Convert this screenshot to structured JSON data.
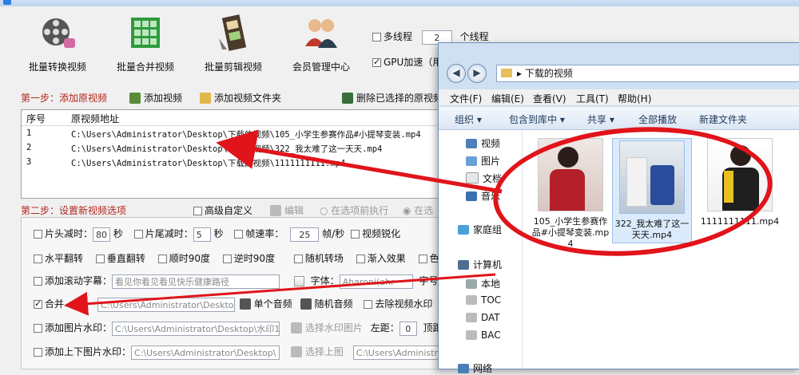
{
  "app": {
    "toolbar": [
      {
        "label": "批量转换视频",
        "icon": "film-reel-icon"
      },
      {
        "label": "批量合并视频",
        "icon": "merge-grid-icon"
      },
      {
        "label": "批量剪辑视频",
        "icon": "film-edit-icon"
      },
      {
        "label": "会员管理中心",
        "icon": "members-icon"
      }
    ],
    "multithread": {
      "label": "多线程",
      "value": "2",
      "suffix": "个线程",
      "checked": false
    },
    "gpu": {
      "label": "GPU加速（用",
      "checked": true
    },
    "step1": {
      "title": "第一步：添加原视频",
      "add_video": "添加视频",
      "add_folder": "添加视频文件夹",
      "delete_selected": "删除已选择的原视频"
    },
    "file_list": {
      "columns": [
        "序号",
        "原视频地址"
      ],
      "rows": [
        {
          "index": "1",
          "path": "C:\\Users\\Administrator\\Desktop\\下载的视频\\105_小学生参赛作品#小提琴变装.mp4"
        },
        {
          "index": "2",
          "path": "C:\\Users\\Administrator\\Desktop\\下载的视频\\322_我太难了这一天天.mp4"
        },
        {
          "index": "3",
          "path": "C:\\Users\\Administrator\\Desktop\\下载的视频\\1111111111.mp4"
        }
      ]
    },
    "step2": {
      "title": "第二步：设置新视频选项",
      "advanced": "高级自定义",
      "edit": "编辑",
      "before_exec": "在选项前执行",
      "after_exec": "在选"
    },
    "options": {
      "head_cut": "片头减时：",
      "head_value": "80",
      "sec1": "秒",
      "tail_cut": "片尾减时：",
      "tail_value": "5",
      "sec2": "秒",
      "fps": "帧速率：",
      "fps_value": "25",
      "fps_unit": "帧/秒",
      "sharpen": "视频锐化",
      "hflip": "水平翻转",
      "vflip": "垂直翻转",
      "rot_cw": "顺时90度",
      "rot_ccw": "逆时90度",
      "random_transition": "随机转场",
      "fade_in": "渐入效果",
      "color": "色彩",
      "scroll_subtitle": "添加滚动字幕：",
      "subtitle_text": "看见你看见看见快乐健康路径",
      "font_label": "字体：",
      "font_value": "Aharoni(ahr",
      "size_label": "字号",
      "merge_audio": "合并",
      "audio_path": "C:\\Users\\Administrator\\Desktop",
      "single_audio": "单个音频",
      "random_audio": "随机音频",
      "remove_watermark": "去除视频水印",
      "image_watermark": "添加图片水印：",
      "watermark_path": "C:\\Users\\Administrator\\Desktop\\水印1",
      "choose_watermark": "选择水印图片",
      "left_label": "左距：",
      "left_value": "0",
      "top_label": "顶距",
      "topbottom_watermark": "添加上下图片水印：",
      "top_img_path": "C:\\Users\\Administrator\\Desktop\\",
      "choose_top": "选择上图",
      "bottom_img_path": "C:\\Users\\Administrator\\"
    }
  },
  "explorer": {
    "address": "下载的视频",
    "menu": [
      "文件(F)",
      "编辑(E)",
      "查看(V)",
      "工具(T)",
      "帮助(H)"
    ],
    "commands": [
      "组织 ▾",
      "包含到库中 ▾",
      "共享 ▾",
      "全部播放",
      "新建文件夹"
    ],
    "nav": [
      "视频",
      "图片",
      "文档",
      "音乐",
      "家庭组",
      "计算机",
      "本地",
      "TOC",
      "DAT",
      "BAC",
      "网络"
    ],
    "files": [
      {
        "name": "105_小学生参赛作品#小提琴变装.mp4",
        "selected": false
      },
      {
        "name": "322_我太难了这一天天.mp4",
        "selected": true
      },
      {
        "name": "1111111111.mp4",
        "selected": false
      }
    ]
  },
  "colors": {
    "annotation": "#e0141a",
    "step_title": "#b3261e"
  }
}
